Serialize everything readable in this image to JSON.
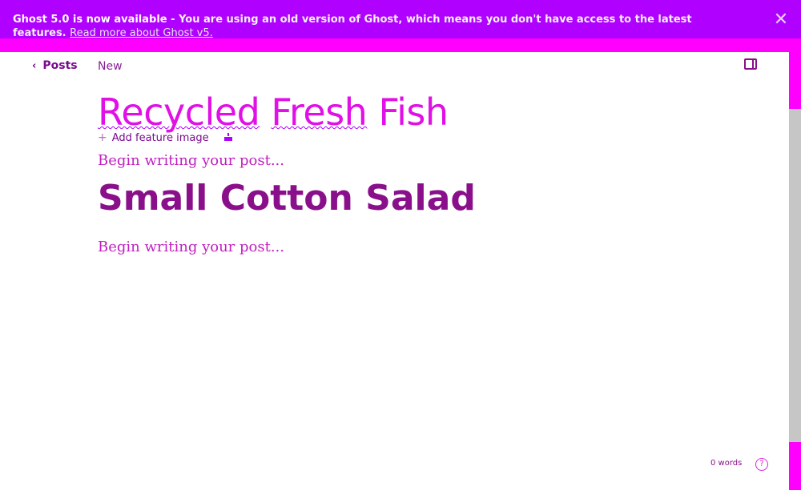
{
  "banner": {
    "bold": "Ghost 5.0 is now available",
    "text": " - You are using an old version of Ghost, which means you don't have access to the latest features. ",
    "link": "Read more about Ghost v5.",
    "close_icon": "close-icon"
  },
  "topbar": {
    "back_label": "Posts",
    "back_icon": "chevron-left-icon",
    "status": "New",
    "sidebar_icon": "sidebar-toggle-icon"
  },
  "editor": {
    "title_part1": "Recycled",
    "title_part2": "Fresh",
    "title_part3": "Fish",
    "feature_label": "Add feature image",
    "placeholder1": "Begin writing your post...",
    "heading2": "Small Cotton Salad",
    "placeholder2": "Begin writing your post..."
  },
  "footer": {
    "word_count": "0 words",
    "help_label": "?"
  },
  "colors": {
    "banner_bg": "#b000ff",
    "accent": "#ff00ff",
    "text": "#8a0f8a"
  }
}
